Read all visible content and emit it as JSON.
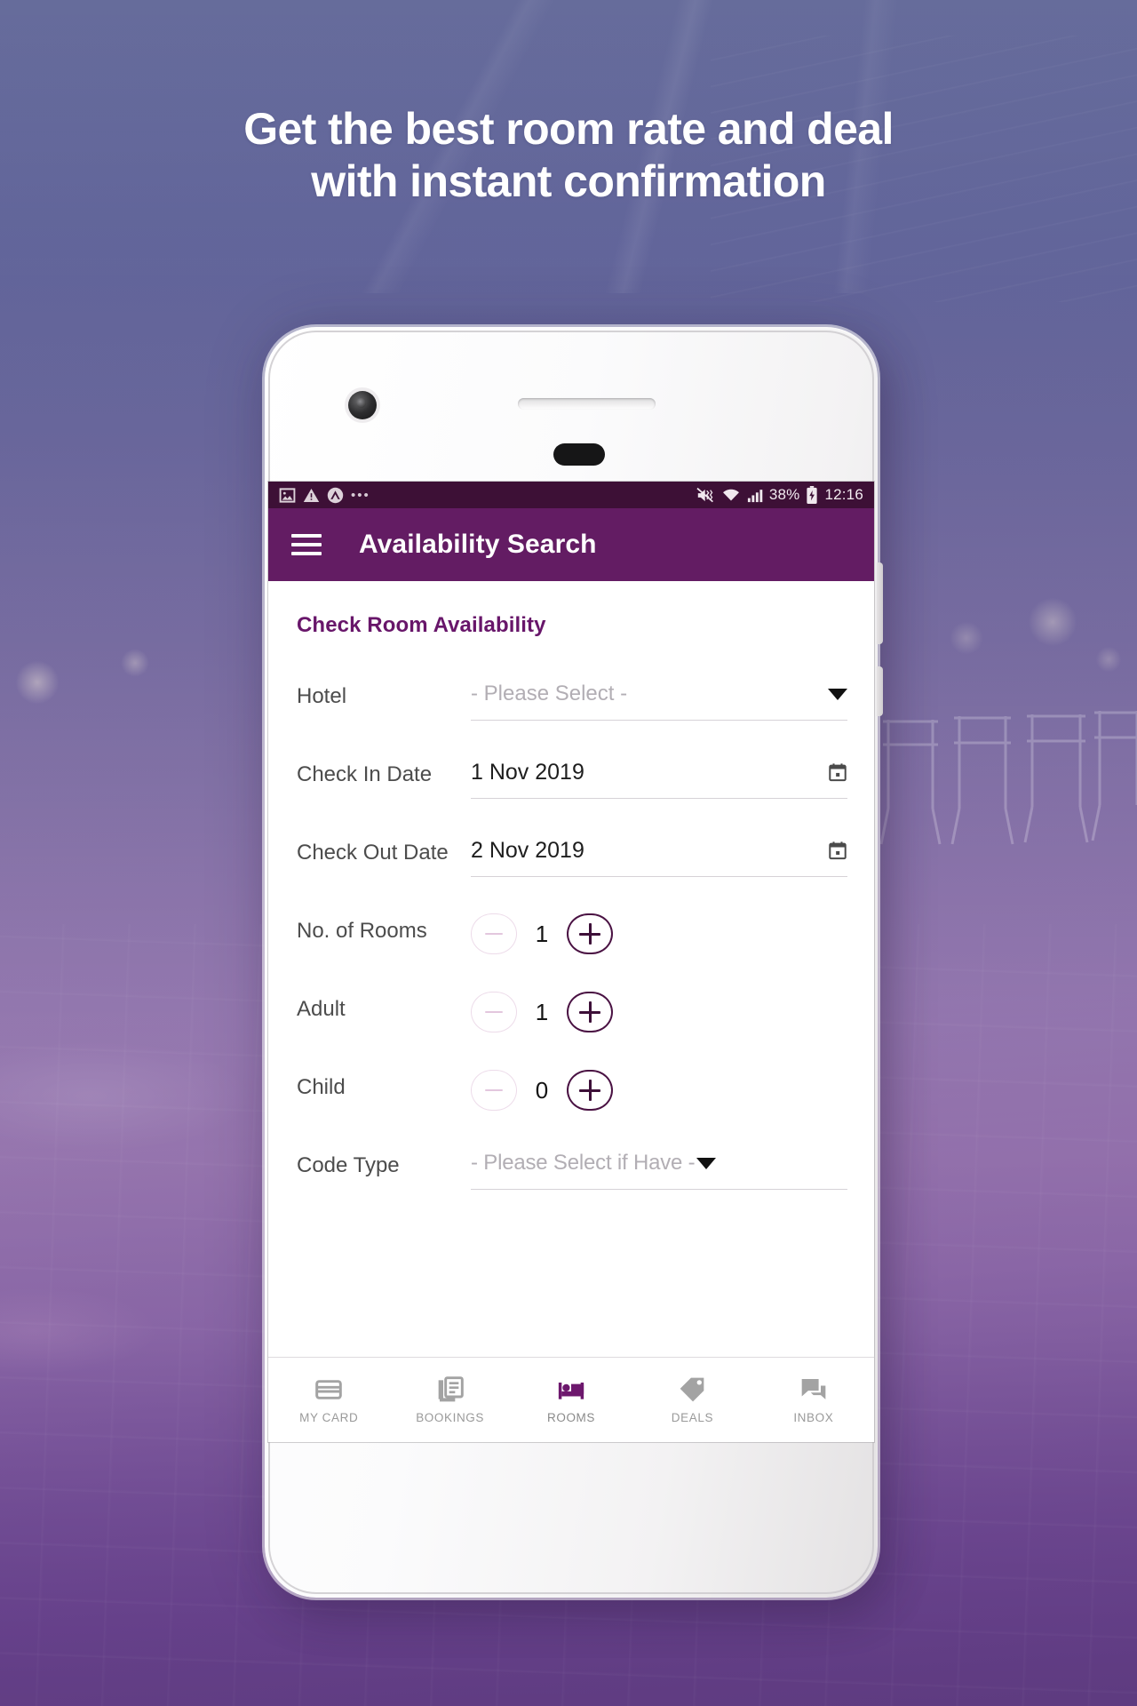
{
  "headline": {
    "line1": "Get the best room rate and deal",
    "line2": "with instant confirmation"
  },
  "colors": {
    "brand_purple": "#631c63",
    "statusbar_purple": "#3d1036",
    "accent_dark": "#3d0f38",
    "disabled_pink": "#e3c7de",
    "background_start": "#5e6496",
    "background_end": "#644989"
  },
  "phone": {
    "statusbar": {
      "left_icons": [
        "image-icon",
        "warning-triangle-icon",
        "caret-up-circle-icon"
      ],
      "overflow": "•••",
      "right_icons": [
        "mute-vibrate-icon",
        "wifi-icon",
        "signal-bars-icon",
        "battery-charging-icon"
      ],
      "battery_percent": "38%",
      "time": "12:16"
    },
    "appbar": {
      "menu_icon": "hamburger-icon",
      "title": "Availability Search"
    },
    "form": {
      "section_title": "Check Room Availability",
      "fields": [
        {
          "label": "Hotel",
          "type": "select",
          "value": "- Please Select -"
        },
        {
          "label": "Check In Date",
          "type": "date",
          "value": "1 Nov 2019"
        },
        {
          "label": "Check Out Date",
          "type": "date",
          "value": "2 Nov 2019"
        },
        {
          "label": "No. of Rooms",
          "type": "stepper",
          "value": "1"
        },
        {
          "label": "Adult",
          "type": "stepper",
          "value": "1"
        },
        {
          "label": "Child",
          "type": "stepper",
          "value": "0"
        },
        {
          "label": "Code Type",
          "type": "select",
          "value": "- Please Select if Have -"
        }
      ]
    },
    "bottom_nav": {
      "active_index": 2,
      "items": [
        {
          "label": "MY CARD",
          "icon": "credit-card-icon"
        },
        {
          "label": "BOOKINGS",
          "icon": "book-icon"
        },
        {
          "label": "ROOMS",
          "icon": "bed-icon"
        },
        {
          "label": "DEALS",
          "icon": "tag-icon"
        },
        {
          "label": "INBOX",
          "icon": "chat-icon"
        }
      ]
    }
  }
}
